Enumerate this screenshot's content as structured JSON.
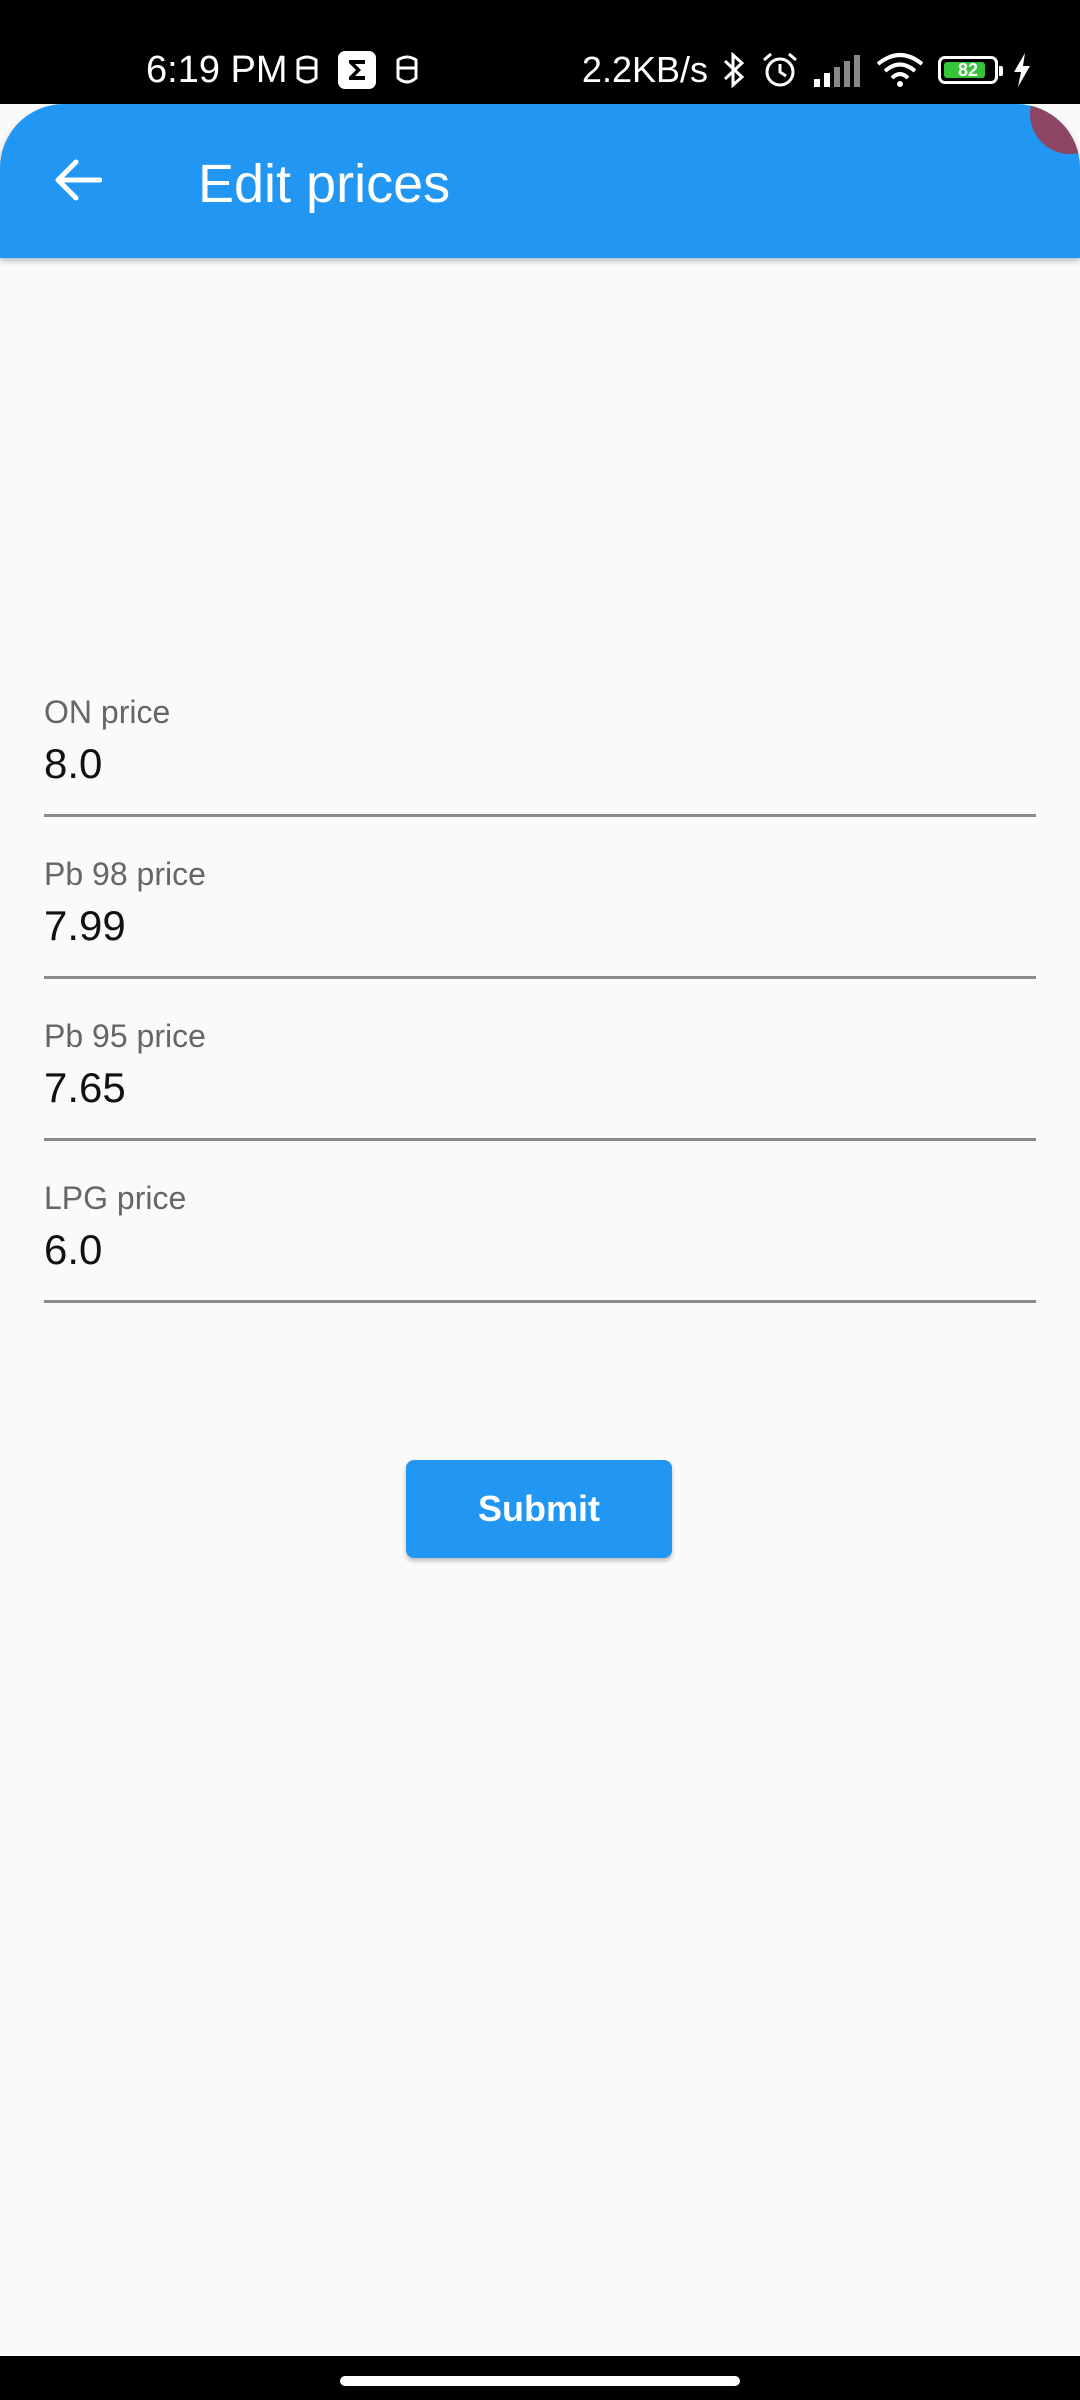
{
  "status_bar": {
    "time": "6:19 PM",
    "network_speed": "2.2KB/s",
    "battery_level": "82",
    "icons": [
      "notification-icon",
      "sigma-app-icon",
      "notification-icon",
      "bluetooth-icon",
      "alarm-icon",
      "signal-icon",
      "wifi-icon",
      "battery-icon",
      "charging-icon"
    ]
  },
  "app_bar": {
    "title": "Edit prices",
    "back_icon": "arrow-back-icon",
    "color": "#2196f3"
  },
  "form": {
    "fields": [
      {
        "label": "ON price",
        "value": "8.0"
      },
      {
        "label": "Pb 98 price",
        "value": "7.99"
      },
      {
        "label": "Pb 95 price",
        "value": "7.65"
      },
      {
        "label": "LPG price",
        "value": "6.0"
      }
    ],
    "submit_label": "Submit"
  }
}
